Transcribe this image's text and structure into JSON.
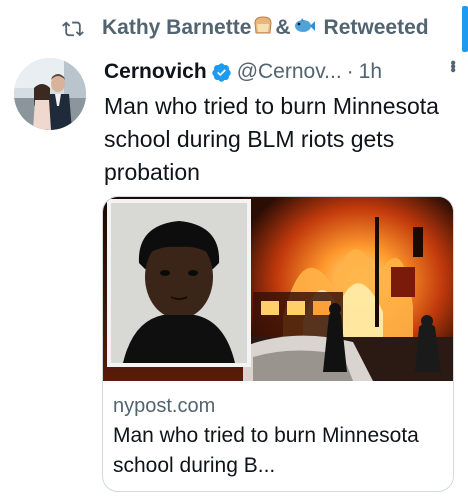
{
  "retweet": {
    "name": "Kathy Barnette",
    "emoji_between": "&",
    "label": "Retweeted"
  },
  "tweet": {
    "display_name": "Cernovich",
    "handle": "@Cernov...",
    "separator": "·",
    "time": "1h",
    "text": "Man who tried to burn Minnesota school during BLM riots gets probation"
  },
  "card": {
    "domain": "nypost.com",
    "title": "Man who tried to burn Minnesota school during B..."
  },
  "icons": {
    "retweet": "retweet-icon",
    "verified": "verified-badge-icon",
    "more": "more-options-icon"
  },
  "colors": {
    "verified_blue": "#1d9bf0",
    "secondary_text": "#536471",
    "primary_text": "#0f1419"
  }
}
